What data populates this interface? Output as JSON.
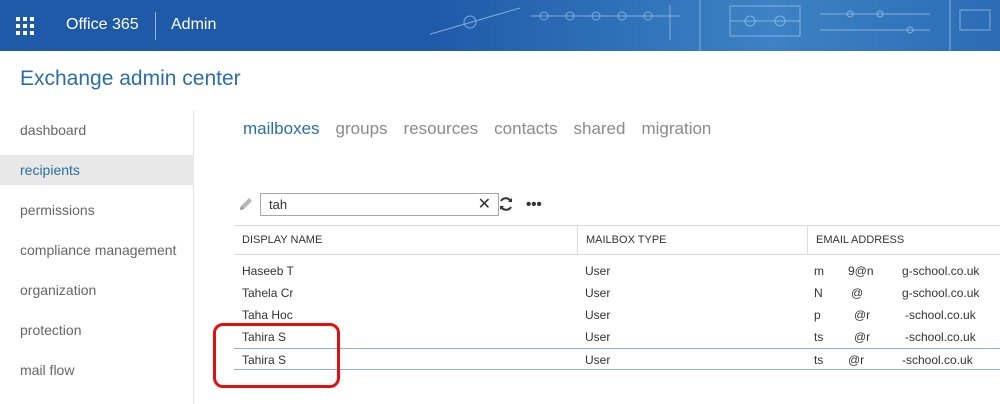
{
  "header": {
    "brand": "Office 365",
    "app": "Admin",
    "colors": {
      "bar": "#1f5aa8",
      "accent": "#2a6fa5"
    }
  },
  "page": {
    "title": "Exchange admin center"
  },
  "sidebar": {
    "items": [
      {
        "label": "dashboard",
        "active": false
      },
      {
        "label": "recipients",
        "active": true
      },
      {
        "label": "permissions",
        "active": false
      },
      {
        "label": "compliance management",
        "active": false
      },
      {
        "label": "organization",
        "active": false
      },
      {
        "label": "protection",
        "active": false
      },
      {
        "label": "mail flow",
        "active": false
      }
    ]
  },
  "tabs": [
    {
      "label": "mailboxes",
      "active": true
    },
    {
      "label": "groups",
      "active": false
    },
    {
      "label": "resources",
      "active": false
    },
    {
      "label": "contacts",
      "active": false
    },
    {
      "label": "shared",
      "active": false
    },
    {
      "label": "migration",
      "active": false
    }
  ],
  "toolbar": {
    "search_value": "tah",
    "icons": [
      "pencil-icon",
      "close-icon",
      "refresh-icon",
      "more-icon"
    ]
  },
  "table": {
    "columns": [
      "DISPLAY NAME",
      "MAILBOX TYPE",
      "EMAIL ADDRESS"
    ],
    "rows": [
      {
        "name": "Haseeb T",
        "type": "User",
        "email": "m",
        "email2": "9@n",
        "email3": "g-school.co.uk"
      },
      {
        "name": "Tahela Cr",
        "type": "User",
        "email": "N",
        "email2": "@",
        "email3": "g-school.co.uk"
      },
      {
        "name": "Taha Hoc",
        "type": "User",
        "email": "p",
        "email2": "@r",
        "email3": "-school.co.uk"
      },
      {
        "name": "Tahira S",
        "type": "User",
        "email": "ts",
        "email2": "@r",
        "email3": "-school.co.uk"
      },
      {
        "name": "Tahira S",
        "type": "User",
        "email": "ts",
        "email2": "@r",
        "email3": "-school.co.uk"
      }
    ],
    "selected_row": 4
  }
}
